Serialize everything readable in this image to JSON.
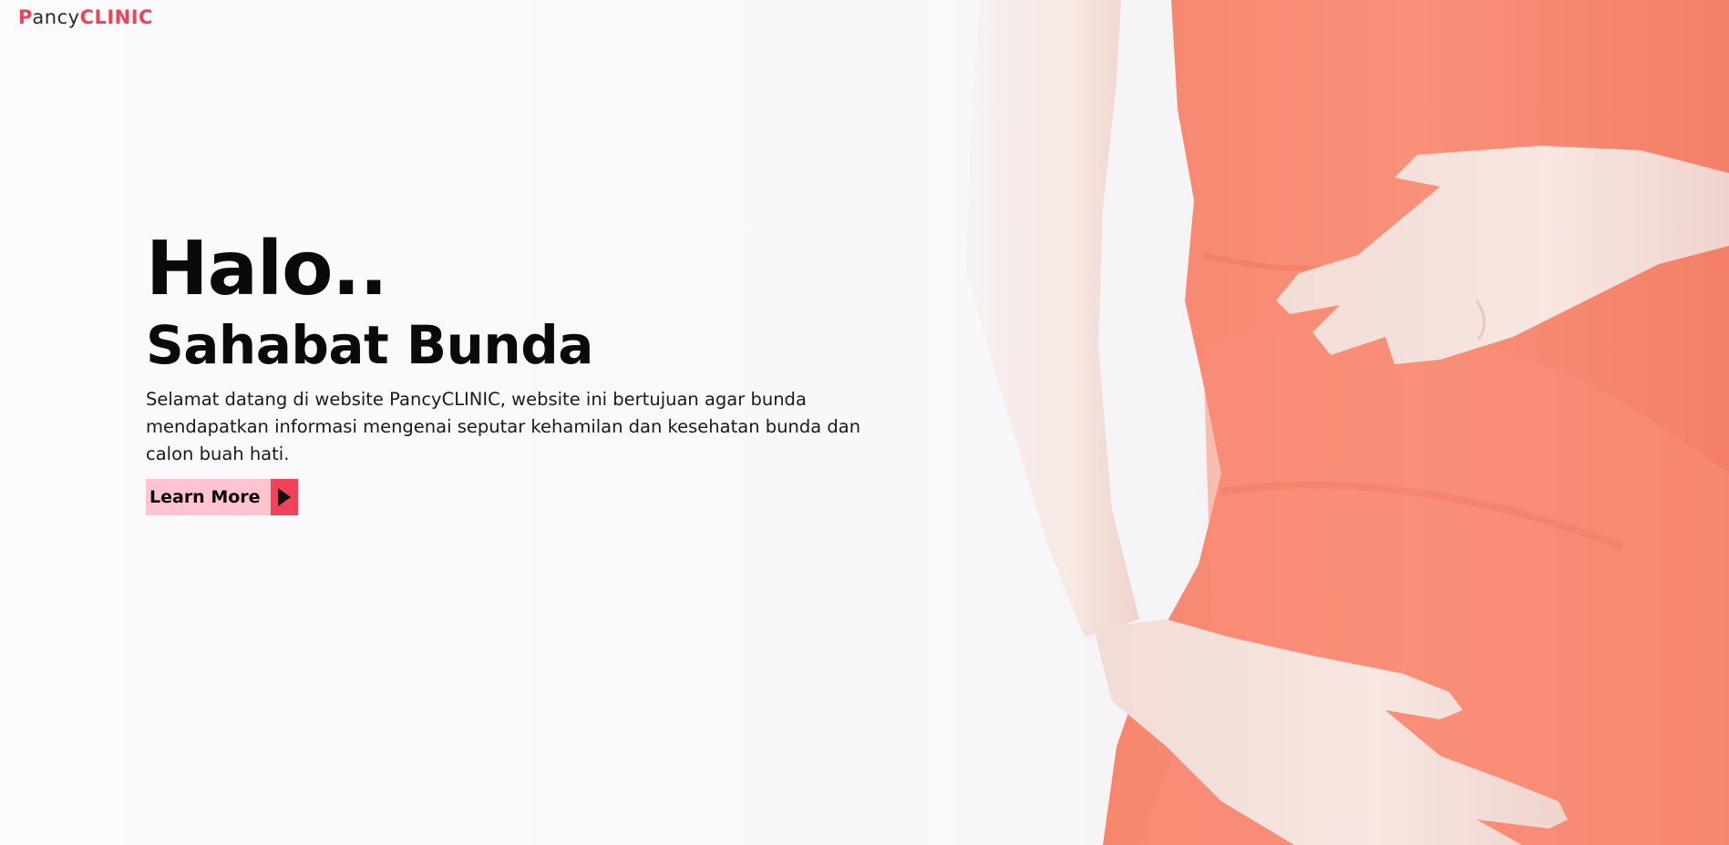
{
  "brand": {
    "initial": "P",
    "rest": "ancy",
    "clinic": "CLINIC"
  },
  "hero": {
    "greeting": "Halo..",
    "subtitle": "Sahabat Bunda",
    "description": "Selamat datang di website PancyCLINIC, website ini bertujuan agar bunda mendapatkan informasi mengenai seputar kehamilan dan kesehatan bunda dan calon buah hati.",
    "cta_label": "Learn More",
    "cta_icon": "play-arrow-icon",
    "image": "pregnant-woman-photo"
  },
  "colors": {
    "accent": "#f0435a",
    "cta_background": "#ffc4d0",
    "text": "#0a0a0a",
    "dress": "#f7826d"
  }
}
